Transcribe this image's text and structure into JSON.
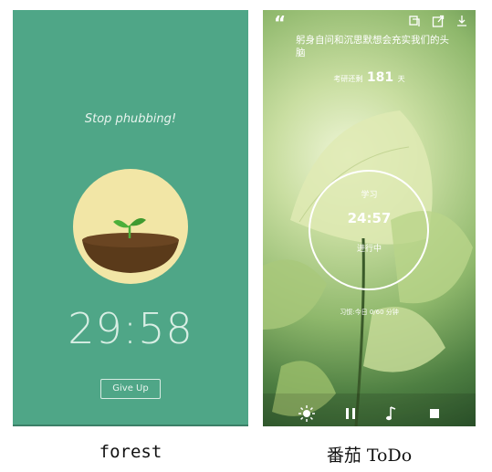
{
  "forest": {
    "title": "Stop phubbing!",
    "timer": "29:58",
    "give_up_label": "Give Up",
    "caption": "forest",
    "colors": {
      "background": "#4fa687",
      "circle": "#f2e6a6",
      "soil": "#5a3a1a",
      "sprout": "#4caf3a"
    }
  },
  "todo": {
    "quote_mark": "“",
    "quote": "躬身自问和沉思默想会充实我们的头脑",
    "countdown_prefix": "考研还剩",
    "countdown_days": "181",
    "countdown_suffix": "天",
    "task_name": "学习",
    "timer": "24:57",
    "status": "进行中",
    "stats": "习惯:今日 0/60 分钟",
    "caption": "番茄 ToDo",
    "top_icons": [
      "copy-icon",
      "share-icon",
      "download-icon"
    ],
    "control_icons": [
      "brightness-icon",
      "pause-icon",
      "music-icon",
      "stop-icon"
    ]
  }
}
